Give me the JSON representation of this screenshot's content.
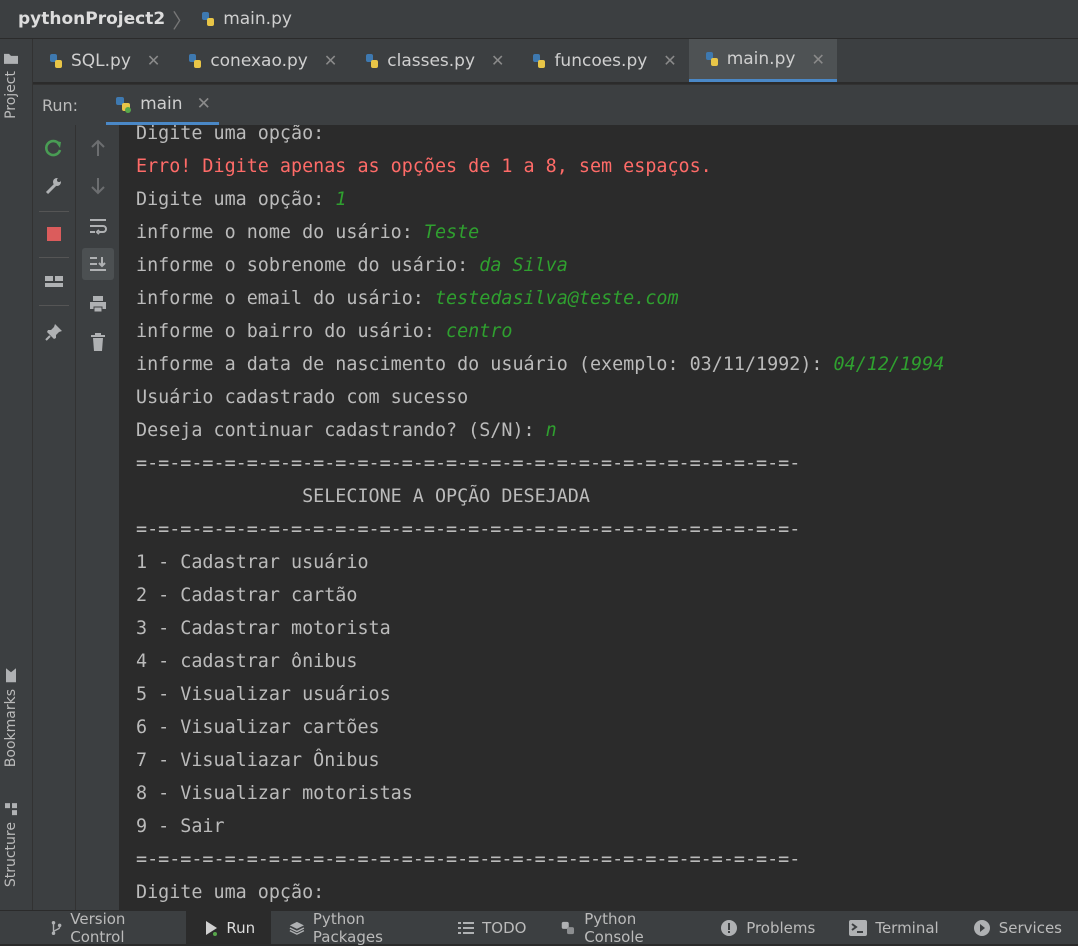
{
  "breadcrumb": {
    "project": "pythonProject2",
    "file": "main.py"
  },
  "editor_tabs": [
    {
      "label": "SQL.py",
      "active": false
    },
    {
      "label": "conexao.py",
      "active": false
    },
    {
      "label": "classes.py",
      "active": false
    },
    {
      "label": "funcoes.py",
      "active": false
    },
    {
      "label": "main.py",
      "active": true
    }
  ],
  "left_strip": {
    "project": "Project",
    "bookmarks": "Bookmarks",
    "structure": "Structure"
  },
  "run_panel": {
    "label": "Run:",
    "tab": "main"
  },
  "console_lines": [
    {
      "text": "Digite uma opção:",
      "input": "",
      "error": false
    },
    {
      "text": "Erro! Digite apenas as opções de 1 a 8, sem espaços.",
      "input": "",
      "error": true
    },
    {
      "text": "Digite uma opção: ",
      "input": "1",
      "error": false
    },
    {
      "text": "informe o nome do usário: ",
      "input": "Teste",
      "error": false
    },
    {
      "text": "informe o sobrenome do usário: ",
      "input": "da Silva",
      "error": false
    },
    {
      "text": "informe o email do usário: ",
      "input": "testedasilva@teste.com",
      "error": false
    },
    {
      "text": "informe o bairro do usário: ",
      "input": "centro",
      "error": false
    },
    {
      "text": "informe a data de nascimento do usuário (exemplo: 03/11/1992): ",
      "input": "04/12/1994",
      "error": false
    },
    {
      "text": "Usuário cadastrado com sucesso",
      "input": "",
      "error": false
    },
    {
      "text": "Deseja continuar cadastrando? (S/N): ",
      "input": "n",
      "error": false
    },
    {
      "text": "=-=-=-=-=-=-=-=-=-=-=-=-=-=-=-=-=-=-=-=-=-=-=-=-=-=-=-=-=-=-",
      "input": "",
      "error": false
    },
    {
      "text": "               SELECIONE A OPÇÃO DESEJADA",
      "input": "",
      "error": false
    },
    {
      "text": "=-=-=-=-=-=-=-=-=-=-=-=-=-=-=-=-=-=-=-=-=-=-=-=-=-=-=-=-=-=-",
      "input": "",
      "error": false
    },
    {
      "text": "1 - Cadastrar usuário",
      "input": "",
      "error": false
    },
    {
      "text": "2 - Cadastrar cartão",
      "input": "",
      "error": false
    },
    {
      "text": "3 - Cadastrar motorista",
      "input": "",
      "error": false
    },
    {
      "text": "4 - cadastrar ônibus",
      "input": "",
      "error": false
    },
    {
      "text": "5 - Visualizar usuários",
      "input": "",
      "error": false
    },
    {
      "text": "6 - Visualizar cartões",
      "input": "",
      "error": false
    },
    {
      "text": "7 - Visualiazar Ônibus",
      "input": "",
      "error": false
    },
    {
      "text": "8 - Visualizar motoristas",
      "input": "",
      "error": false
    },
    {
      "text": "9 - Sair",
      "input": "",
      "error": false
    },
    {
      "text": "=-=-=-=-=-=-=-=-=-=-=-=-=-=-=-=-=-=-=-=-=-=-=-=-=-=-=-=-=-=-",
      "input": "",
      "error": false
    },
    {
      "text": "Digite uma opção:",
      "input": "",
      "error": false
    }
  ],
  "status_bar": [
    {
      "label": "Version Control",
      "icon": "version-control-icon",
      "active": false
    },
    {
      "label": "Run",
      "icon": "run-icon",
      "active": true
    },
    {
      "label": "Python Packages",
      "icon": "layers-icon",
      "active": false
    },
    {
      "label": "TODO",
      "icon": "list-icon",
      "active": false
    },
    {
      "label": "Python Console",
      "icon": "python-icon",
      "active": false
    },
    {
      "label": "Problems",
      "icon": "problems-icon",
      "active": false
    },
    {
      "label": "Terminal",
      "icon": "terminal-icon",
      "active": false
    },
    {
      "label": "Services",
      "icon": "services-icon",
      "active": false
    }
  ],
  "colors": {
    "error": "#ff6b68",
    "user_input": "#2fa02f",
    "accent": "#4a88c7",
    "rerun_green": "#499c54",
    "stop_red": "#db5c5c"
  }
}
